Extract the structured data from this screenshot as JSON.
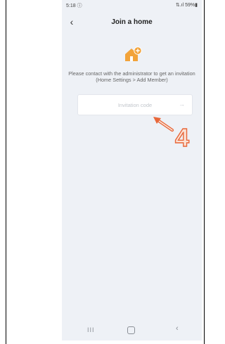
{
  "status": {
    "time": "5:18 ⓘ",
    "right": "⇅.ıl 59%▮"
  },
  "header": {
    "back_icon": "‹",
    "title": "Join a home"
  },
  "content": {
    "instructions": "Please contact with the administrator to get an invitation (Home Settings > Add Member)",
    "invitation_placeholder": "Invitation code",
    "submit_arrow": "→"
  },
  "annotation": {
    "label": "4",
    "color": "#e8673a"
  },
  "nav": {
    "recent": "III",
    "back": "‹"
  },
  "colors": {
    "home_icon": "#f2a33a",
    "background": "#eef1f6"
  }
}
